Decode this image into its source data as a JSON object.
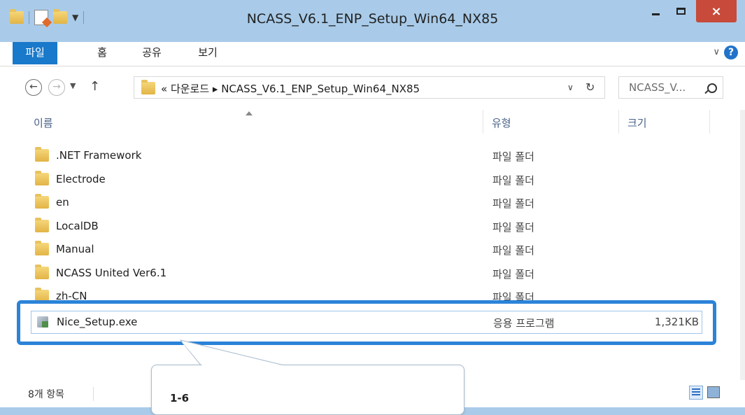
{
  "window": {
    "title": "NCASS_V6.1_ENP_Setup_Win64_NX85",
    "close_glyph": "×"
  },
  "ribbon": {
    "tabs": [
      "파일",
      "홈",
      "공유",
      "보기"
    ],
    "help_glyph": "?"
  },
  "nav": {
    "back_glyph": "←",
    "forward_glyph": "→",
    "recent_glyph": "▼",
    "up_glyph": "↑",
    "address": "« 다운로드 ▸ NCASS_V6.1_ENP_Setup_Win64_NX85",
    "address_dropdown": "∨",
    "refresh_glyph": "↻",
    "search_placeholder": "NCASS_V..."
  },
  "columns": {
    "name": "이름",
    "type": "유형",
    "size": "크기"
  },
  "files": [
    {
      "name": ".NET Framework",
      "type": "파일 폴더",
      "size": "",
      "icon": "folder-icon"
    },
    {
      "name": "Electrode",
      "type": "파일 폴더",
      "size": "",
      "icon": "folder-icon"
    },
    {
      "name": "en",
      "type": "파일 폴더",
      "size": "",
      "icon": "folder-icon"
    },
    {
      "name": "LocalDB",
      "type": "파일 폴더",
      "size": "",
      "icon": "folder-icon"
    },
    {
      "name": "Manual",
      "type": "파일 폴더",
      "size": "",
      "icon": "folder-icon"
    },
    {
      "name": "NCASS United Ver6.1",
      "type": "파일 폴더",
      "size": "",
      "icon": "folder-icon"
    },
    {
      "name": "zh-CN",
      "type": "파일 폴더",
      "size": "",
      "icon": "folder-icon"
    },
    {
      "name": "Nice_Setup.exe",
      "type": "응용 프로그램",
      "size": "1,321KB",
      "icon": "exe-icon"
    }
  ],
  "status": {
    "item_count": "8개 항목"
  },
  "callout": {
    "label": "1-6"
  },
  "colors": {
    "accent": "#1979ca",
    "highlight_border": "#2b83d8",
    "titlebar": "#a9cbe9",
    "close": "#c74a3b"
  }
}
